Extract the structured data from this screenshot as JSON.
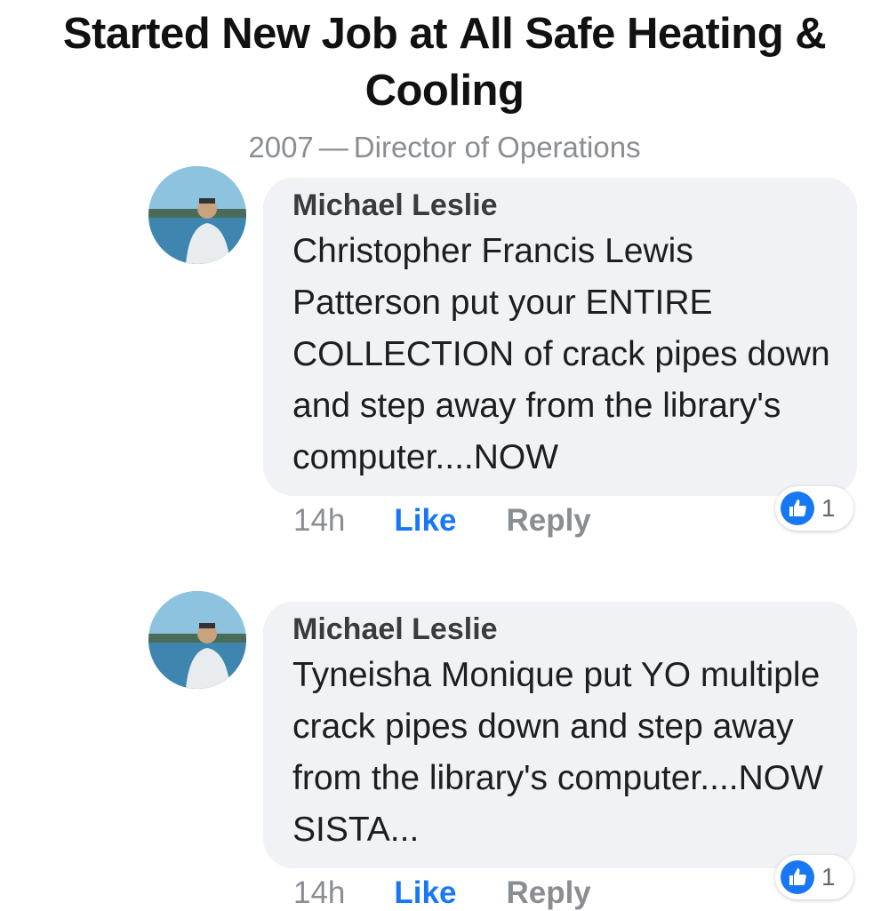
{
  "header": {
    "title_lead": "Started New Job at",
    "company": "All Safe Heating & Cooling",
    "year": "2007",
    "separator": "—",
    "role": "Director of Operations"
  },
  "comments": [
    {
      "author": "Michael Leslie",
      "text": "Christopher Francis Lewis Patterson put your ENTIRE COLLECTION of crack pipes down and step away from the library's computer....NOW",
      "time": "14h",
      "like_label": "Like",
      "reply_label": "Reply",
      "reaction_count": "1",
      "reaction_icon": "thumbs-up-icon"
    },
    {
      "author": "Michael Leslie",
      "text": "Tyneisha Monique put YO multiple crack pipes down and step away from the library's computer....NOW SISTA...",
      "time": "14h",
      "like_label": "Like",
      "reply_label": "Reply",
      "reaction_count": "1",
      "reaction_icon": "thumbs-up-icon"
    }
  ],
  "colors": {
    "link_blue": "#1877f2",
    "bubble_bg": "#f0f2f5",
    "muted_text": "#8a8d91"
  }
}
